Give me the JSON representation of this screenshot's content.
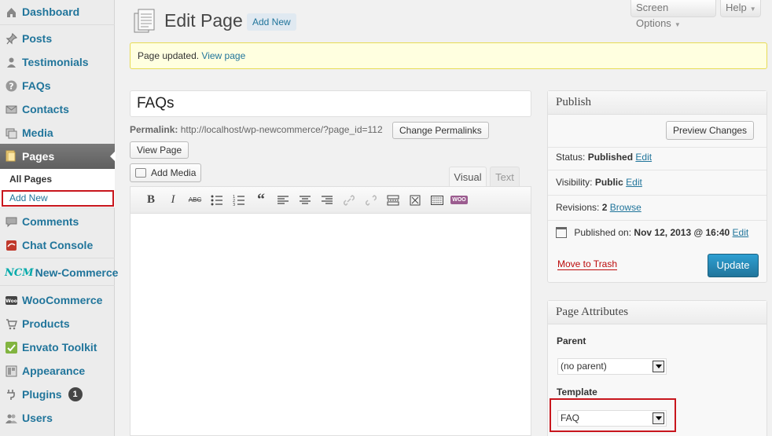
{
  "sidebar": {
    "items": [
      {
        "label": "Dashboard",
        "icon": "dashboard-icon"
      },
      {
        "label": "Posts",
        "icon": "pin-icon"
      },
      {
        "label": "Testimonials",
        "icon": "user-icon"
      },
      {
        "label": "FAQs",
        "icon": "question-icon"
      },
      {
        "label": "Contacts",
        "icon": "mail-icon"
      },
      {
        "label": "Media",
        "icon": "media-icon"
      },
      {
        "label": "Pages",
        "icon": "pages-icon"
      },
      {
        "label": "Comments",
        "icon": "comment-icon"
      },
      {
        "label": "Chat Console",
        "icon": "chat-icon"
      },
      {
        "label": "New-Commerce",
        "icon": "ncm-logo"
      },
      {
        "label": "WooCommerce",
        "icon": "woo-icon"
      },
      {
        "label": "Products",
        "icon": "cart-icon"
      },
      {
        "label": "Envato Toolkit",
        "icon": "check-icon"
      },
      {
        "label": "Appearance",
        "icon": "appearance-icon"
      },
      {
        "label": "Plugins",
        "icon": "plug-icon",
        "badge": "1"
      },
      {
        "label": "Users",
        "icon": "users-icon"
      }
    ],
    "submenu": {
      "all_pages": "All Pages",
      "add_new": "Add New"
    },
    "ncm_logo_text": "NCM"
  },
  "header": {
    "title": "Edit Page",
    "add_new": "Add New",
    "screen_options": "Screen Options",
    "help": "Help"
  },
  "notice": {
    "text": "Page updated.",
    "link": "View page"
  },
  "editor": {
    "title_value": "FAQs",
    "permalink_label": "Permalink:",
    "permalink_url": "http://localhost/wp-newcommerce/?page_id=112",
    "change_permalinks": "Change Permalinks",
    "view_page": "View Page",
    "add_media": "Add Media",
    "tab_visual": "Visual",
    "tab_text": "Text"
  },
  "publish": {
    "title": "Publish",
    "preview_changes": "Preview Changes",
    "status_label": "Status:",
    "status_value": "Published",
    "visibility_label": "Visibility:",
    "visibility_value": "Public",
    "revisions_label": "Revisions:",
    "revisions_value": "2",
    "browse": "Browse",
    "published_on_label": "Published on:",
    "published_on_value": "Nov 12, 2013 @ 16:40",
    "edit": "Edit",
    "move_to_trash": "Move to Trash",
    "update": "Update"
  },
  "attributes": {
    "title": "Page Attributes",
    "parent_label": "Parent",
    "parent_value": "(no parent)",
    "template_label": "Template",
    "template_value": "FAQ"
  },
  "colors": {
    "link": "#21759b",
    "highlight": "#c8161d",
    "primary_button": "#21759b"
  }
}
